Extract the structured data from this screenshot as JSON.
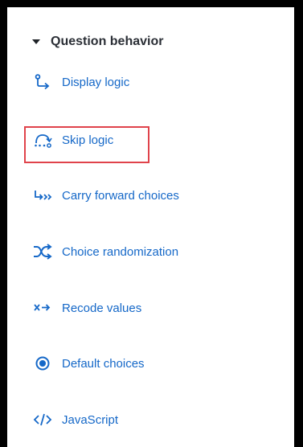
{
  "section": {
    "title": "Question behavior",
    "items": [
      {
        "label": "Display logic",
        "icon": "display-logic-icon"
      },
      {
        "label": "Skip logic",
        "icon": "skip-logic-icon",
        "highlighted": true
      },
      {
        "label": "Carry forward choices",
        "icon": "carry-forward-icon"
      },
      {
        "label": "Choice randomization",
        "icon": "shuffle-icon"
      },
      {
        "label": "Recode values",
        "icon": "recode-icon"
      },
      {
        "label": "Default choices",
        "icon": "radio-selected-icon"
      },
      {
        "label": "JavaScript",
        "icon": "code-icon"
      }
    ]
  },
  "colors": {
    "link": "#1568c8",
    "header_text": "#2b2f36",
    "highlight_border": "#e0434b",
    "frame": "#000000"
  }
}
